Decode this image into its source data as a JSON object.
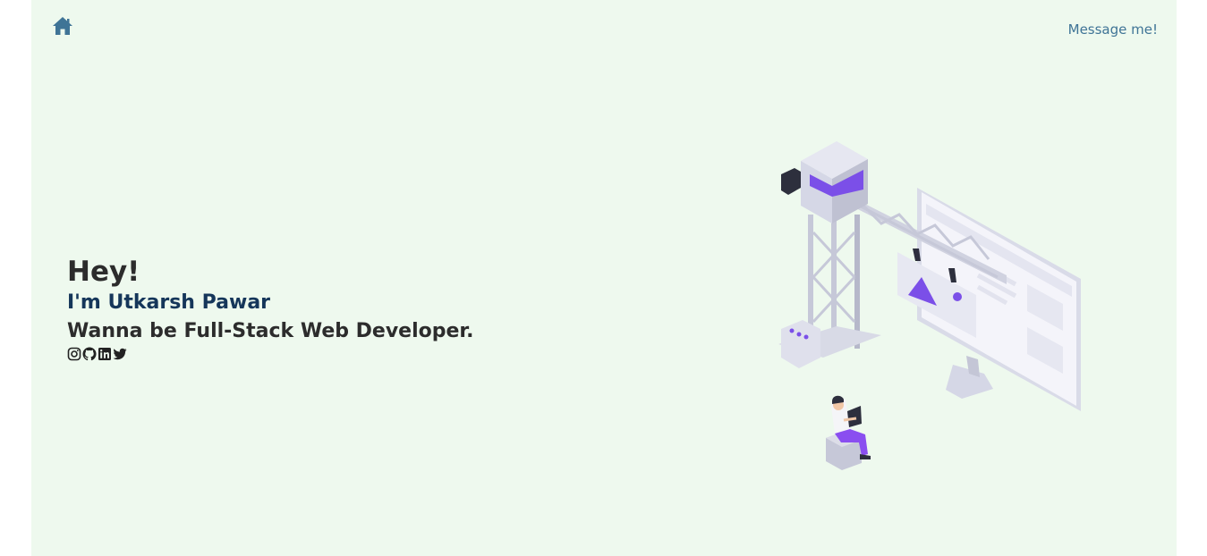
{
  "nav": {
    "home_icon": "home-icon",
    "message_label": "Message me!"
  },
  "hero": {
    "greeting": "Hey!",
    "name_line": "I'm Utkarsh Pawar",
    "role_line": "Wanna be Full-Stack Web Developer."
  },
  "socials": [
    {
      "icon": "instagram-icon"
    },
    {
      "icon": "github-icon"
    },
    {
      "icon": "linkedin-icon"
    },
    {
      "icon": "twitter-icon"
    }
  ],
  "colors": {
    "page_background": "#eef9ee",
    "accent_blue": "#3f7496",
    "name_color": "#15365a",
    "text_dark": "#2c2c2c",
    "illustration_purple": "#7b4fe8"
  }
}
